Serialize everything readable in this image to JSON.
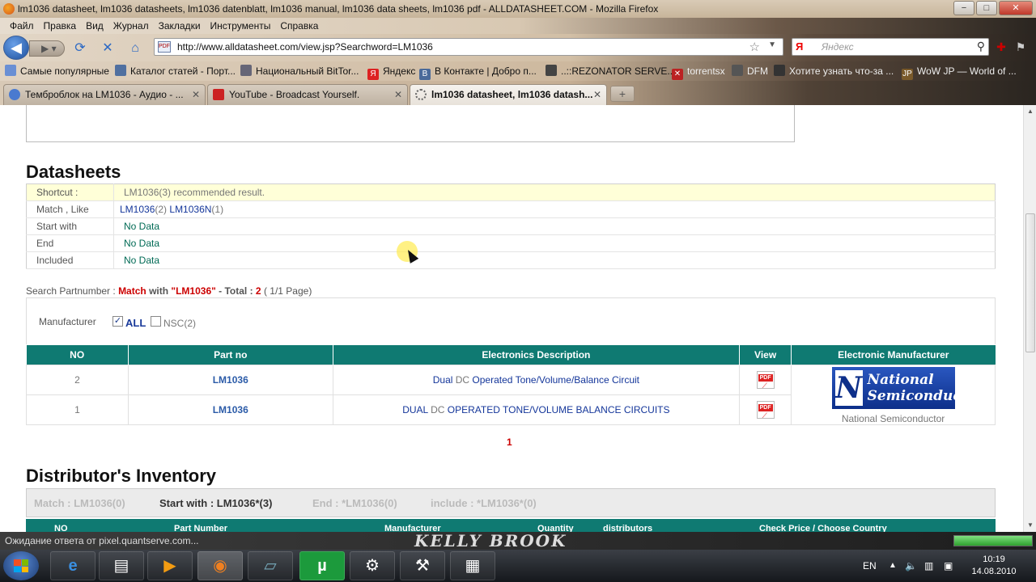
{
  "window": {
    "title": "lm1036 datasheet, lm1036 datasheets, lm1036 datenblatt, lm1036 manual, lm1036 data sheets, lm1036 pdf - ALLDATASHEET.COM - Mozilla Firefox",
    "controls": [
      "−",
      "□",
      "✕"
    ]
  },
  "menu": [
    "Файл",
    "Правка",
    "Вид",
    "Журнал",
    "Закладки",
    "Инструменты",
    "Справка"
  ],
  "nav": {
    "url": "http://www.alldatasheet.com/view.jsp?Searchword=LM1036",
    "search_placeholder": "Яндекс",
    "search_logo": "Я"
  },
  "bookmarks": [
    {
      "label": "Самые популярные",
      "icon": "bookmark-icon",
      "color": "#6a8fd4"
    },
    {
      "label": "Каталог статей - Порт...",
      "icon": "catalog-icon",
      "color": "#5070a0"
    },
    {
      "label": "Национальный BitTor...",
      "icon": "torrent-icon",
      "color": "#667"
    },
    {
      "label": "Яндекс",
      "icon": "yandex-icon",
      "color": "#d22"
    },
    {
      "label": "В Контакте | Добро п...",
      "icon": "vk-icon",
      "color": "#4a6a9a"
    },
    {
      "label": "..::REZONATOR SERVE...",
      "icon": "rezonator-icon",
      "color": "#444"
    },
    {
      "label": "torrentsx",
      "icon": "torrentsx-icon",
      "color": "#b22"
    },
    {
      "label": "DFM",
      "icon": "dfm-icon",
      "color": "#555"
    },
    {
      "label": "Хотите узнать что-за ...",
      "icon": "web-icon",
      "color": "#333"
    },
    {
      "label": "WoW JP — World of ...",
      "icon": "wow-icon",
      "color": "#7a5a2a"
    }
  ],
  "tabs": [
    {
      "label": "Темброблок на LM1036 - Аудио - ...",
      "active": false
    },
    {
      "label": "YouTube - Broadcast Yourself.",
      "active": false
    },
    {
      "label": "lm1036 datasheet, lm1036 datash...",
      "active": true
    }
  ],
  "page": {
    "datasheets_title": "Datasheets",
    "rows": [
      {
        "key": "Shortcut :",
        "value": "LM1036(3) recommended result."
      },
      {
        "key": "Match , Like",
        "links": [
          {
            "text": "LM1036",
            "count": "(2)"
          },
          {
            "text": "LM1036N",
            "count": "(1)"
          }
        ]
      },
      {
        "key": "Start with",
        "value": "No Data"
      },
      {
        "key": "End",
        "value": "No Data"
      },
      {
        "key": "Included",
        "value": "No Data"
      }
    ],
    "search_line": {
      "prefix": "Search Partnumber : ",
      "match": "Match",
      "with": " with ",
      "word": "\"LM1036\"",
      "total_label": " - Total : ",
      "total": "2",
      "pages": " ( 1/1 Page)"
    },
    "manufacturer_label": "Manufacturer",
    "filter_all": "ALL",
    "filter_nsc": "NSC(2)",
    "results_headers": [
      "NO",
      "Part no",
      "Electronics Description",
      "View",
      "Electronic Manufacturer"
    ],
    "results": [
      {
        "no": "2",
        "part": "LM1036",
        "desc_a": "Dual",
        "desc_b": " DC ",
        "desc_c": "Operated Tone/Volume/Balance Circuit"
      },
      {
        "no": "1",
        "part": "LM1036",
        "desc_a": "DUAL",
        "desc_b": " DC ",
        "desc_c": "OPERATED TONE/VOLUME BALANCE CIRCUITS"
      }
    ],
    "pdf_badge": "PDF",
    "logo_line1": "National",
    "logo_line2": "Semiconductor",
    "manufacturer_name": "National Semiconductor",
    "pager": "1",
    "inventory_title": "Distributor's Inventory",
    "inventory_filters": [
      "Match : LM1036(0)",
      "Start with : LM1036*(3)",
      "End : *LM1036(0)",
      "include : *LM1036*(0)"
    ],
    "inventory_headers": [
      "NO",
      "Part Number",
      "Manufacturer",
      "Quantity",
      "distributors",
      "Check Price / Choose Country"
    ]
  },
  "status": {
    "text": "Ожидание ответа от pixel.quantserve.com...",
    "brand": "KELLY BROOK",
    "progress": 1.0
  },
  "taskbar": {
    "lang": "EN",
    "time": "10:19",
    "date": "14.08.2010"
  }
}
